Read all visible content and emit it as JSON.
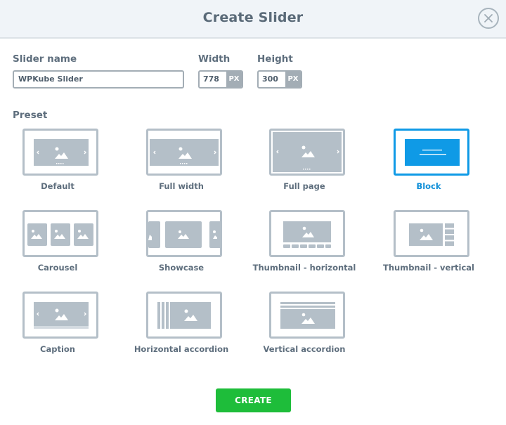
{
  "dialog": {
    "title": "Create Slider",
    "close_icon": "close-icon"
  },
  "form": {
    "slider_name": {
      "label": "Slider name",
      "value": "WPKube Slider"
    },
    "width": {
      "label": "Width",
      "value": "778",
      "unit": "PX"
    },
    "height": {
      "label": "Height",
      "value": "300",
      "unit": "PX"
    },
    "preset_label": "Preset"
  },
  "presets": [
    {
      "label": "Default",
      "selected": false
    },
    {
      "label": "Full width",
      "selected": false
    },
    {
      "label": "Full page",
      "selected": false
    },
    {
      "label": "Block",
      "selected": true
    },
    {
      "label": "Carousel",
      "selected": false
    },
    {
      "label": "Showcase",
      "selected": false
    },
    {
      "label": "Thumbnail - horizontal",
      "selected": false
    },
    {
      "label": "Thumbnail - vertical",
      "selected": false
    },
    {
      "label": "Caption",
      "selected": false
    },
    {
      "label": "Horizontal accordion",
      "selected": false
    },
    {
      "label": "Vertical accordion",
      "selected": false
    }
  ],
  "actions": {
    "create_label": "CREATE"
  },
  "colors": {
    "accent": "#0f9ae6",
    "primary_button": "#1ebd3a",
    "preset_gray": "#b4bfc8"
  }
}
